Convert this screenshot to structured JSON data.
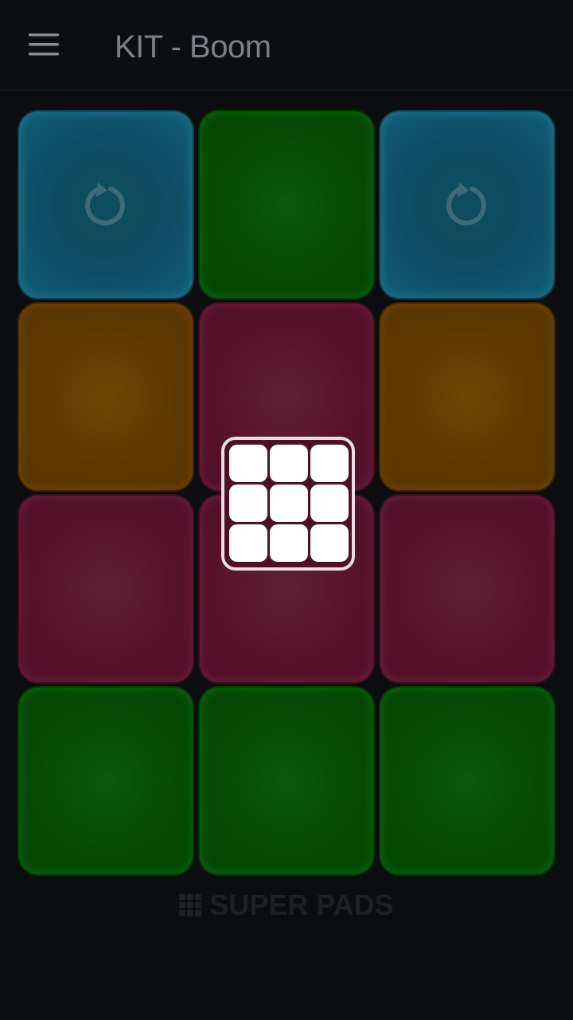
{
  "header": {
    "title": "KIT - Boom",
    "menu_icon": "hamburger-menu-icon"
  },
  "colors": {
    "background": "#0c0d0f",
    "blue": "#0f4d60",
    "green": "#064a06",
    "orange": "#5b3801",
    "magenta": "#551329",
    "title_text": "#7d8086",
    "overlay_border": "#e9dfe4"
  },
  "pads": [
    {
      "color": "blue",
      "icon": "loop-icon"
    },
    {
      "color": "green",
      "icon": ""
    },
    {
      "color": "blue",
      "icon": "loop-icon"
    },
    {
      "color": "orange",
      "icon": ""
    },
    {
      "color": "magenta",
      "icon": ""
    },
    {
      "color": "orange",
      "icon": ""
    },
    {
      "color": "magenta",
      "icon": ""
    },
    {
      "color": "magenta",
      "icon": ""
    },
    {
      "color": "magenta",
      "icon": ""
    },
    {
      "color": "green",
      "icon": ""
    },
    {
      "color": "green",
      "icon": ""
    },
    {
      "color": "green",
      "icon": ""
    }
  ],
  "overlay": {
    "icon": "pad-grid-icon"
  },
  "brand": {
    "icon": "grid-icon",
    "label": "SUPER PADS"
  }
}
